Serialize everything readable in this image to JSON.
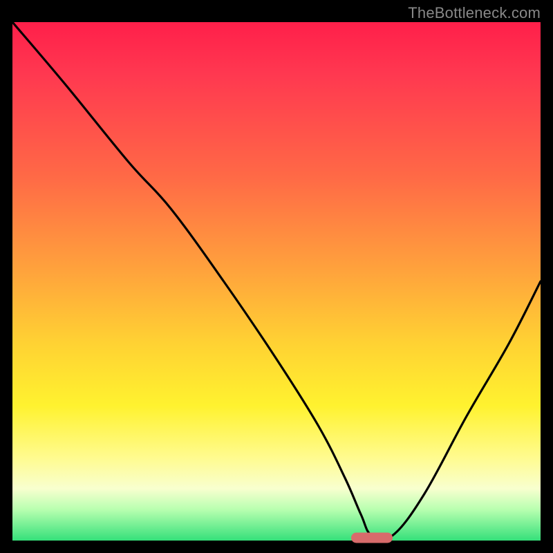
{
  "watermark": "TheBottleneck.com",
  "colors": {
    "gradient_top": "#ff1f4a",
    "gradient_mid_orange": "#ffa33c",
    "gradient_mid_yellow": "#ffd233",
    "gradient_bottom_green": "#35e07a",
    "curve": "#000000",
    "pill": "#d86b6b",
    "frame": "#000000",
    "watermark_text": "#888888"
  },
  "chart_data": {
    "type": "line",
    "title": "",
    "xlabel": "",
    "ylabel": "",
    "xlim": [
      0,
      100
    ],
    "ylim": [
      0,
      100
    ],
    "grid": false,
    "legend": false,
    "series": [
      {
        "name": "curve",
        "x": [
          0,
          10,
          22,
          30,
          40,
          50,
          58,
          63,
          66,
          68,
          72,
          78,
          86,
          94,
          100
        ],
        "values": [
          100,
          88,
          73,
          64,
          50,
          35,
          22,
          12,
          5,
          1,
          1,
          9,
          24,
          38,
          50
        ]
      }
    ],
    "marker": {
      "name": "bottleneck-pill",
      "x": 68,
      "y": 0
    }
  }
}
